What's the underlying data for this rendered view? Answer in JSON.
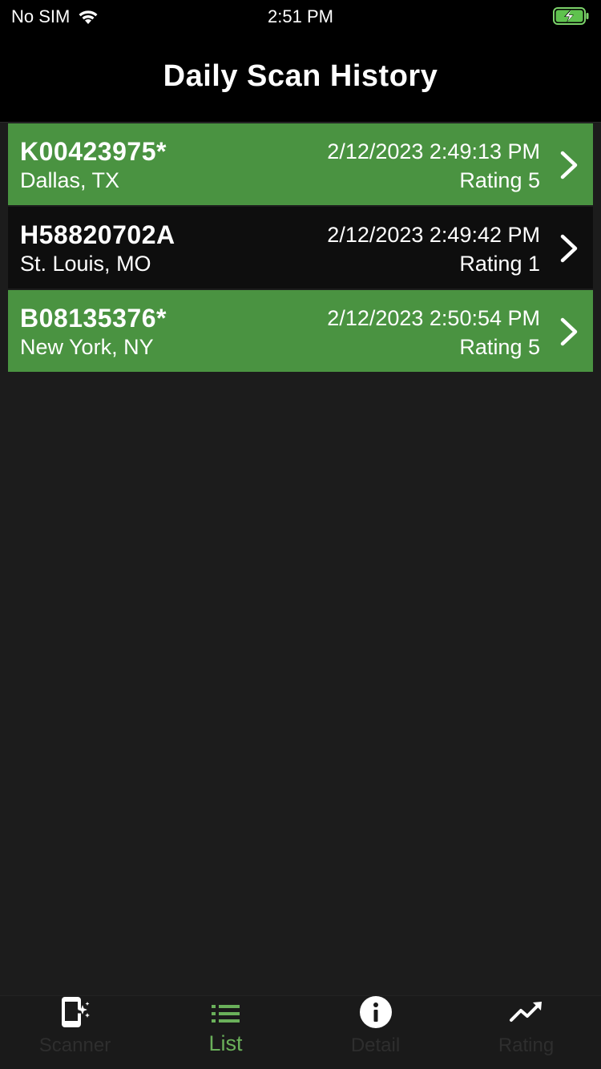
{
  "status_bar": {
    "carrier": "No SIM",
    "time": "2:51 PM"
  },
  "nav": {
    "title": "Daily Scan History"
  },
  "colors": {
    "accent_green": "#4a9341",
    "active_tab": "#6ab05a",
    "background": "#1c1c1c"
  },
  "scans": [
    {
      "id": "K00423975*",
      "city": "Dallas, TX",
      "timestamp": "2/12/2023 2:49:13 PM",
      "rating": "Rating 5",
      "style": "green"
    },
    {
      "id": "H58820702A",
      "city": "St. Louis, MO",
      "timestamp": "2/12/2023 2:49:42 PM",
      "rating": "Rating 1",
      "style": "dark"
    },
    {
      "id": "B08135376*",
      "city": "New York, NY",
      "timestamp": "2/12/2023 2:50:54 PM",
      "rating": "Rating 5",
      "style": "green"
    }
  ],
  "tabs": [
    {
      "label": "Scanner",
      "icon": "scanner-icon",
      "active": false
    },
    {
      "label": "List",
      "icon": "list-icon",
      "active": true
    },
    {
      "label": "Detail",
      "icon": "info-icon",
      "active": false
    },
    {
      "label": "Rating",
      "icon": "trending-up-icon",
      "active": false
    }
  ]
}
